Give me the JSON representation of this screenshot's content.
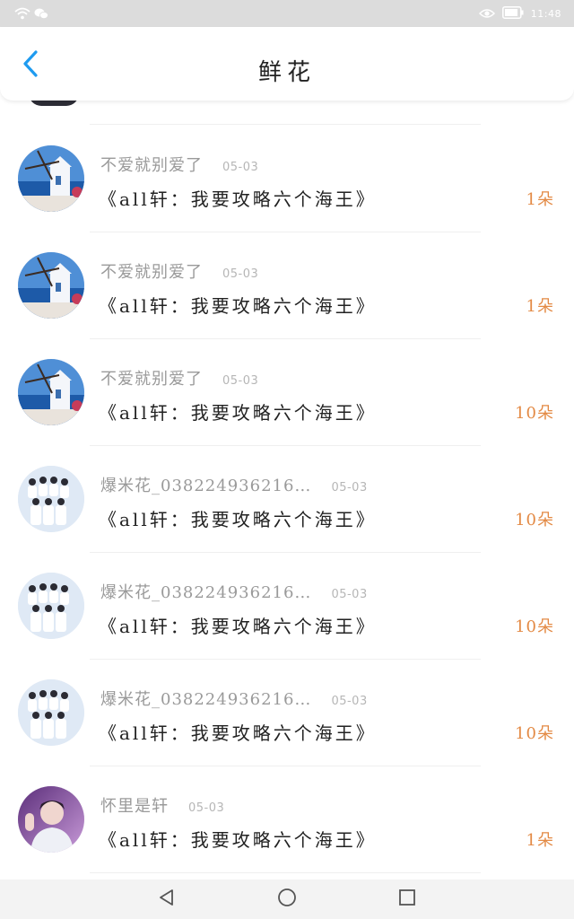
{
  "status_bar": {
    "time": "11:48",
    "icons": [
      "wifi-icon",
      "wechat-icon",
      "eye-icon",
      "battery-icon"
    ]
  },
  "header": {
    "title": "鲜花",
    "back_icon": "chevron-left-icon",
    "accent_color": "#1e9bf0"
  },
  "records": [
    {
      "user": "不爱就别爱了",
      "date": "05-03",
      "book": "《all轩：我要攻略六个海王》",
      "amount": "1朵",
      "avatar": "windmill"
    },
    {
      "user": "不爱就别爱了",
      "date": "05-03",
      "book": "《all轩：我要攻略六个海王》",
      "amount": "1朵",
      "avatar": "windmill"
    },
    {
      "user": "不爱就别爱了",
      "date": "05-03",
      "book": "《all轩：我要攻略六个海王》",
      "amount": "10朵",
      "avatar": "windmill"
    },
    {
      "user": "爆米花_038224936216…",
      "date": "05-03",
      "book": "《all轩：我要攻略六个海王》",
      "amount": "10朵",
      "avatar": "group"
    },
    {
      "user": "爆米花_038224936216…",
      "date": "05-03",
      "book": "《all轩：我要攻略六个海王》",
      "amount": "10朵",
      "avatar": "group"
    },
    {
      "user": "爆米花_038224936216…",
      "date": "05-03",
      "book": "《all轩：我要攻略六个海王》",
      "amount": "10朵",
      "avatar": "group"
    },
    {
      "user": "怀里是轩",
      "date": "05-03",
      "book": "《all轩：我要攻略六个海王》",
      "amount": "1朵",
      "avatar": "portrait"
    }
  ],
  "colors": {
    "amount": "#e38a45",
    "username": "#9a9a9a",
    "title": "#222222"
  },
  "nav_bar": {
    "icons": [
      "back-triangle-icon",
      "home-circle-icon",
      "recents-square-icon"
    ]
  }
}
